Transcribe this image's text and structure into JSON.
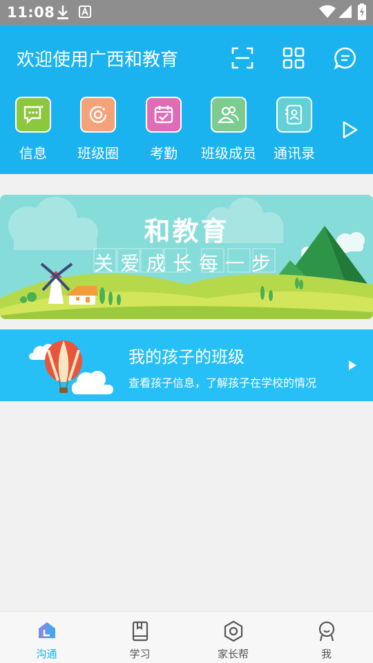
{
  "status_bar": {
    "time": "11:08"
  },
  "header": {
    "title": "欢迎使用广西和教育"
  },
  "shortcuts": [
    {
      "label": "信息",
      "color": "#8dc63f",
      "icon": "message-icon"
    },
    {
      "label": "班级圈",
      "color": "#f4a27a",
      "icon": "class-circle-icon"
    },
    {
      "label": "考勤",
      "color": "#e06bb7",
      "icon": "calendar-check-icon"
    },
    {
      "label": "班级成员",
      "color": "#7ecb8f",
      "icon": "members-icon"
    },
    {
      "label": "通讯录",
      "color": "#62d0d6",
      "icon": "contacts-icon"
    }
  ],
  "banner": {
    "title": "和教育",
    "subtitle": "关爱成长每一步"
  },
  "class_card": {
    "title": "我的孩子的班级",
    "description": "查看孩子信息，了解孩子在学校的情况"
  },
  "bottom_nav": [
    {
      "label": "沟通",
      "icon": "chat-home-icon",
      "active": true
    },
    {
      "label": "学习",
      "icon": "book-icon",
      "active": false
    },
    {
      "label": "家长帮",
      "icon": "hexagon-icon",
      "active": false
    },
    {
      "label": "我",
      "icon": "person-icon",
      "active": false
    }
  ],
  "colors": {
    "primary": "#1ab3ef",
    "card": "#26c0f6",
    "background": "#f1f1f1"
  }
}
